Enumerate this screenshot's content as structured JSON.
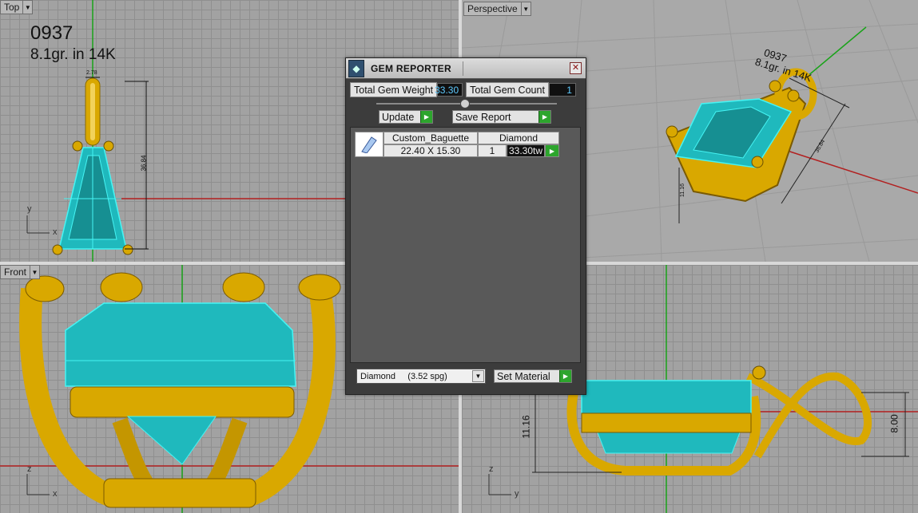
{
  "viewports": {
    "top": {
      "label": "Top",
      "note_line1": "0937",
      "note_line2": "8.1gr.  in 14K",
      "dim_width": "2.78",
      "dim_height": "36.84",
      "axis_x": "x",
      "axis_y": "y"
    },
    "perspective": {
      "label": "Perspective",
      "note_line1": "0937",
      "note_line2": "8.1gr.  in 14K",
      "dim_a": "36.84",
      "dim_b": "11.16"
    },
    "front": {
      "label": "Front",
      "axis_x": "x",
      "axis_z": "z"
    },
    "right": {
      "dim_height": "11.16",
      "dim_loop": "8.00",
      "axis_y": "y",
      "axis_z": "z"
    }
  },
  "dialog": {
    "title": "GEM REPORTER",
    "close_glyph": "✕",
    "total_weight_label": "Total Gem Weight",
    "total_weight_value": "33.30",
    "total_count_label": "Total Gem Count",
    "total_count_value": "1",
    "update_label": "Update",
    "save_report_label": "Save Report",
    "gem": {
      "name": "Custom_Baguette",
      "material": "Diamond",
      "size": "22.40 X 15.30",
      "qty": "1",
      "weight": "33.30tw"
    },
    "material_select": "Diamond     (3.52 spg)",
    "set_material_label": "Set Material"
  },
  "colors": {
    "gold": "#d9a800",
    "gem": "#1fb9bd",
    "gem_edge": "#45f4f4",
    "axis_green": "#19a319",
    "axis_red": "#b22020"
  }
}
